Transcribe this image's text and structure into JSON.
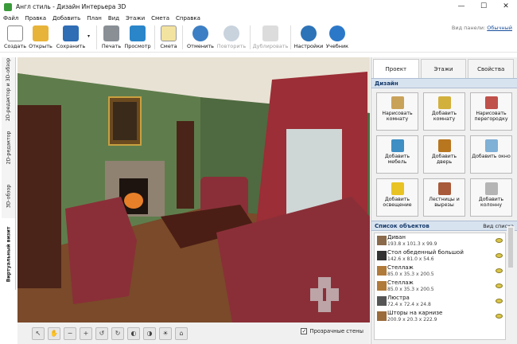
{
  "window": {
    "title": "Англ стиль - Дизайн Интерьера 3D",
    "controls": [
      "—",
      "☐",
      "✕"
    ]
  },
  "menu": {
    "items": [
      "Файл",
      "Правка",
      "Добавить",
      "План",
      "Вид",
      "Этажи",
      "Смета",
      "Справка"
    ]
  },
  "toolbar": {
    "create": "Создать",
    "open": "Открыть",
    "save": "Сохранить",
    "print": "Печать",
    "preview": "Просмотр",
    "estimate": "Смета",
    "undo": "Отменить",
    "redo": "Повторить",
    "duplicate": "Дублировать",
    "settings": "Настройки",
    "tutorial": "Учебник",
    "view_panel_label": "Вид панели:",
    "view_panel_value": "Обычный"
  },
  "left_tabs": {
    "tab1": "2D-редактор и 3D-обзор",
    "tab2": "2D-редактор",
    "tab3": "3D-обзор",
    "tab4": "Виртуальный визит"
  },
  "right_panel": {
    "tabs": {
      "project": "Проект",
      "floors": "Этажи",
      "properties": "Свойства"
    },
    "design": {
      "header": "Дизайн",
      "buttons": [
        {
          "label": "Нарисовать комнату",
          "icon": "draw-room-icon",
          "color": "#c9a25a"
        },
        {
          "label": "Добавить комнату",
          "icon": "add-room-icon",
          "color": "#d2b03c"
        },
        {
          "label": "Нарисовать перегородку",
          "icon": "wall-icon",
          "color": "#c0504a"
        },
        {
          "label": "Добавить мебель",
          "icon": "furniture-icon",
          "color": "#3f8ec4"
        },
        {
          "label": "Добавить дверь",
          "icon": "door-icon",
          "color": "#b8761f"
        },
        {
          "label": "Добавить окно",
          "icon": "window-icon",
          "color": "#7fb0d6"
        },
        {
          "label": "Добавить освещение",
          "icon": "lightbulb-icon",
          "color": "#e8c323"
        },
        {
          "label": "Лестницы и вырезы",
          "icon": "stairs-icon",
          "color": "#a85a3a"
        },
        {
          "label": "Добавить колонну",
          "icon": "column-icon",
          "color": "#b5b5b5"
        }
      ]
    },
    "objects": {
      "header": "Список объектов",
      "view_list": "Вид списка",
      "items": [
        {
          "name": "Диван",
          "dims": "193.8 x 101.3 x 99.9",
          "icon": "sofa-icon",
          "color": "#8a6a4a"
        },
        {
          "name": "Стол обеденный большой",
          "dims": "142.6 x 81.0 x 54.6",
          "icon": "table-icon",
          "color": "#333333"
        },
        {
          "name": "Стеллаж",
          "dims": "85.0 x 35.3 x 200.5",
          "icon": "shelf-icon",
          "color": "#b07a3a"
        },
        {
          "name": "Стеллаж",
          "dims": "85.0 x 35.3 x 200.5",
          "icon": "shelf-icon",
          "color": "#b07a3a"
        },
        {
          "name": "Люстра",
          "dims": "72.4 x 72.4 x 24.8",
          "icon": "chandelier-icon",
          "color": "#555555"
        },
        {
          "name": "Шторы на карнизе",
          "dims": "200.9 x 20.3 x 222.9",
          "icon": "curtains-icon",
          "color": "#9b6b3b"
        }
      ]
    }
  },
  "bottom": {
    "transparent_walls": "Прозрачные стены"
  },
  "colors": {
    "accent": "#d8e3f0",
    "wall_green": "#5d7a4d",
    "curtain": "#9b2e36",
    "floor": "#7a4a2a"
  }
}
